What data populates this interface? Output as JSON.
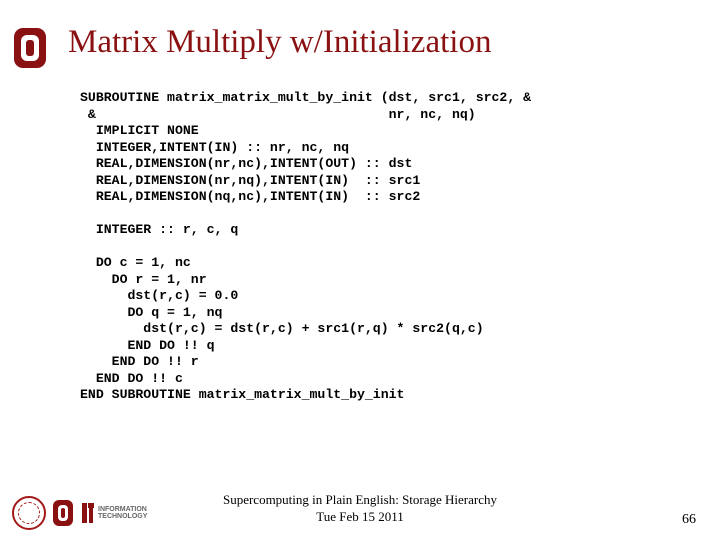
{
  "title": "Matrix Multiply w/Initialization",
  "code": "SUBROUTINE matrix_matrix_mult_by_init (dst, src1, src2, &\n &                                     nr, nc, nq)\n  IMPLICIT NONE\n  INTEGER,INTENT(IN) :: nr, nc, nq\n  REAL,DIMENSION(nr,nc),INTENT(OUT) :: dst\n  REAL,DIMENSION(nr,nq),INTENT(IN)  :: src1\n  REAL,DIMENSION(nq,nc),INTENT(IN)  :: src2\n\n  INTEGER :: r, c, q\n\n  DO c = 1, nc\n    DO r = 1, nr\n      dst(r,c) = 0.0\n      DO q = 1, nq\n        dst(r,c) = dst(r,c) + src1(r,q) * src2(q,c)\n      END DO !! q\n    END DO !! r\n  END DO !! c\nEND SUBROUTINE matrix_matrix_mult_by_init",
  "footer": {
    "line1": "Supercomputing in Plain English: Storage Hierarchy",
    "line2": "Tue Feb 15 2011"
  },
  "page_number": "66",
  "logos": {
    "ou_main": "ou-logo",
    "oscer": "oscer-seal",
    "ou_small": "ou-logo-small",
    "it_line1": "INFORMATION",
    "it_line2": "TECHNOLOGY"
  }
}
